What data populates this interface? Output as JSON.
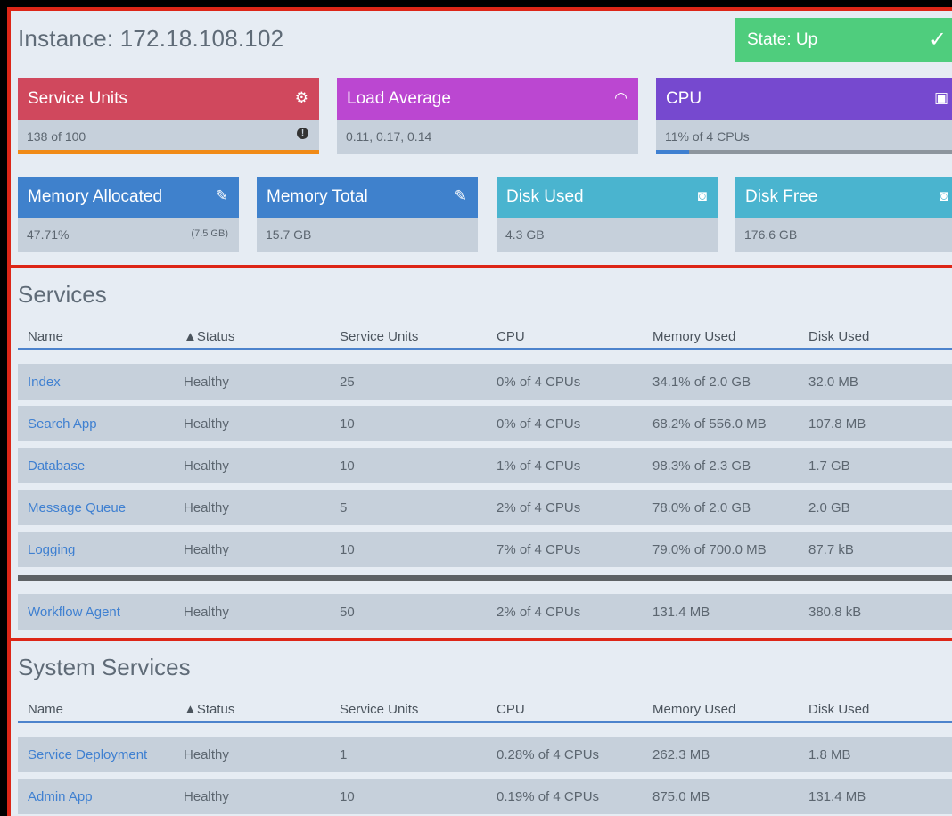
{
  "instance": {
    "title": "Instance: 172.18.108.102",
    "state": {
      "label": "State: Up",
      "icon": "check-icon",
      "color": "#4fcd7d"
    }
  },
  "cards": {
    "service_units": {
      "title": "Service Units",
      "icon": "gears-icon",
      "value": "138 of 100",
      "indicator": "!",
      "progress_percent": 100,
      "bar_color": "#f08a16"
    },
    "load_average": {
      "title": "Load Average",
      "icon": "gauge-icon",
      "value": "0.11, 0.17, 0.14"
    },
    "cpu": {
      "title": "CPU",
      "icon": "chip-icon",
      "value": "11% of 4 CPUs",
      "progress_percent": 11,
      "bar_color": "#3f80d1"
    },
    "memory_allocated": {
      "title": "Memory Allocated",
      "icon": "memory-icon",
      "value": "47.71%",
      "sub": "(7.5 GB)"
    },
    "memory_total": {
      "title": "Memory Total",
      "icon": "memory-icon",
      "value": "15.7 GB"
    },
    "disk_used": {
      "title": "Disk Used",
      "icon": "disk-icon",
      "value": "4.3 GB"
    },
    "disk_free": {
      "title": "Disk Free",
      "icon": "disk-icon",
      "value": "176.6 GB"
    }
  },
  "services": {
    "title": "Services",
    "columns": [
      "Name",
      "▲Status",
      "Service Units",
      "CPU",
      "Memory Used",
      "Disk Used"
    ],
    "rows": [
      [
        "Index",
        "Healthy",
        "25",
        "0% of 4 CPUs",
        "34.1% of 2.0 GB",
        "32.0 MB"
      ],
      [
        "Search App",
        "Healthy",
        "10",
        "0% of 4 CPUs",
        "68.2% of 556.0 MB",
        "107.8 MB"
      ],
      [
        "Database",
        "Healthy",
        "10",
        "1% of 4 CPUs",
        "98.3% of 2.3 GB",
        "1.7 GB"
      ],
      [
        "Message Queue",
        "Healthy",
        "5",
        "2% of 4 CPUs",
        "78.0% of 2.0 GB",
        "2.0 GB"
      ],
      [
        "Logging",
        "Healthy",
        "10",
        "7% of 4 CPUs",
        "79.0% of 700.0 MB",
        "87.7 kB"
      ]
    ],
    "extra_rows": [
      [
        "Workflow Agent",
        "Healthy",
        "50",
        "2% of 4 CPUs",
        "131.4 MB",
        "380.8 kB"
      ]
    ]
  },
  "system_services": {
    "title": "System Services",
    "columns": [
      "Name",
      "▲Status",
      "Service Units",
      "CPU",
      "Memory Used",
      "Disk Used"
    ],
    "rows": [
      [
        "Service Deployment",
        "Healthy",
        "1",
        "0.28% of 4 CPUs",
        "262.3 MB",
        "1.8 MB"
      ],
      [
        "Admin App",
        "Healthy",
        "10",
        "0.19% of 4 CPUs",
        "875.0 MB",
        "131.4 MB"
      ]
    ]
  }
}
